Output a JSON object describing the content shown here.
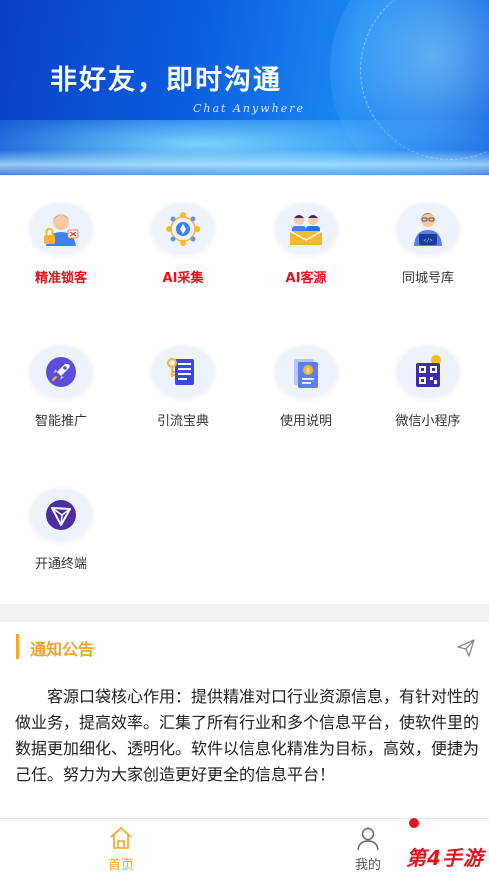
{
  "banner": {
    "title": "非好友，即时沟通",
    "subtitle": "Chat Anywhere"
  },
  "grid": {
    "items": [
      {
        "label": "精准锁客",
        "icon": "customer-lock-icon",
        "hot": true
      },
      {
        "label": "AI采集",
        "icon": "ai-collect-icon",
        "hot": true
      },
      {
        "label": "AI客源",
        "icon": "ai-customers-icon",
        "hot": true
      },
      {
        "label": "同城号库",
        "icon": "local-number-icon",
        "hot": false
      },
      {
        "label": "智能推广",
        "icon": "rocket-icon",
        "hot": false
      },
      {
        "label": "引流宝典",
        "icon": "guide-book-icon",
        "hot": false
      },
      {
        "label": "使用说明",
        "icon": "manual-icon",
        "hot": false
      },
      {
        "label": "微信小程序",
        "icon": "qr-code-icon",
        "hot": false
      },
      {
        "label": "开通终端",
        "icon": "terminal-icon",
        "hot": false
      }
    ]
  },
  "notice": {
    "title": "通知公告",
    "body": "客源口袋核心作用：提供精准对口行业资源信息，有针对性的做业务，提高效率。汇集了所有行业和多个信息平台，使软件里的数据更加细化、透明化。软件以信息化精准为目标，高效，便捷为己任。努力为大家创造更好更全的信息平台！"
  },
  "tabbar": {
    "home": "首页",
    "mine": "我的"
  },
  "watermark": "第4手游",
  "colors": {
    "accent": "#f5a623",
    "hot": "#e0141e",
    "badge": "#e8141d"
  }
}
